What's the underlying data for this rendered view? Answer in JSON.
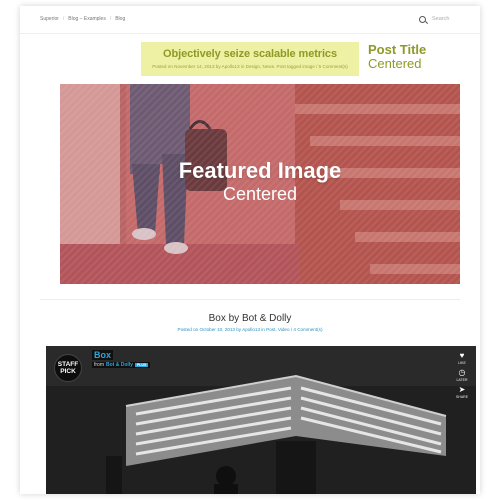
{
  "nav": {
    "breadcrumb": [
      "Superior",
      "Blog – Examples",
      "Blog"
    ],
    "search_placeholder": "Search"
  },
  "post1": {
    "title": "Objectively seize scalable metrics",
    "meta_posted_on": "Posted on November 14, 2013 by Apollo13 in Design, News. Post tagged image / 5 Comment(s)",
    "note_title": "Post Title",
    "note_subtitle": "Centered",
    "featured_title": "Featured Image",
    "featured_subtitle": "Centered"
  },
  "post2": {
    "title": "Box by Bot & Dolly",
    "meta": "Posted on October 10, 2013 by Apollo13 in Post, Video / 4 Comment(s)"
  },
  "video": {
    "badge_line1": "STAFF",
    "badge_line2": "PICK",
    "title": "Box",
    "from_label": "from",
    "author": "Bot & Dolly",
    "plus_tag": "PLUS",
    "actions": [
      {
        "icon": "heart-icon",
        "glyph": "♥",
        "label": "LIKE"
      },
      {
        "icon": "clock-icon",
        "glyph": "◷",
        "label": "LATER"
      },
      {
        "icon": "share-icon",
        "glyph": "➤",
        "label": "SHARE"
      }
    ]
  },
  "colors": {
    "title_green": "#8e9a27",
    "highlight_yellow": "#eef0a4",
    "featured_pink": "#c9706e",
    "link_blue": "#2a8fbf",
    "vimeo_blue": "#2aa7dd"
  }
}
